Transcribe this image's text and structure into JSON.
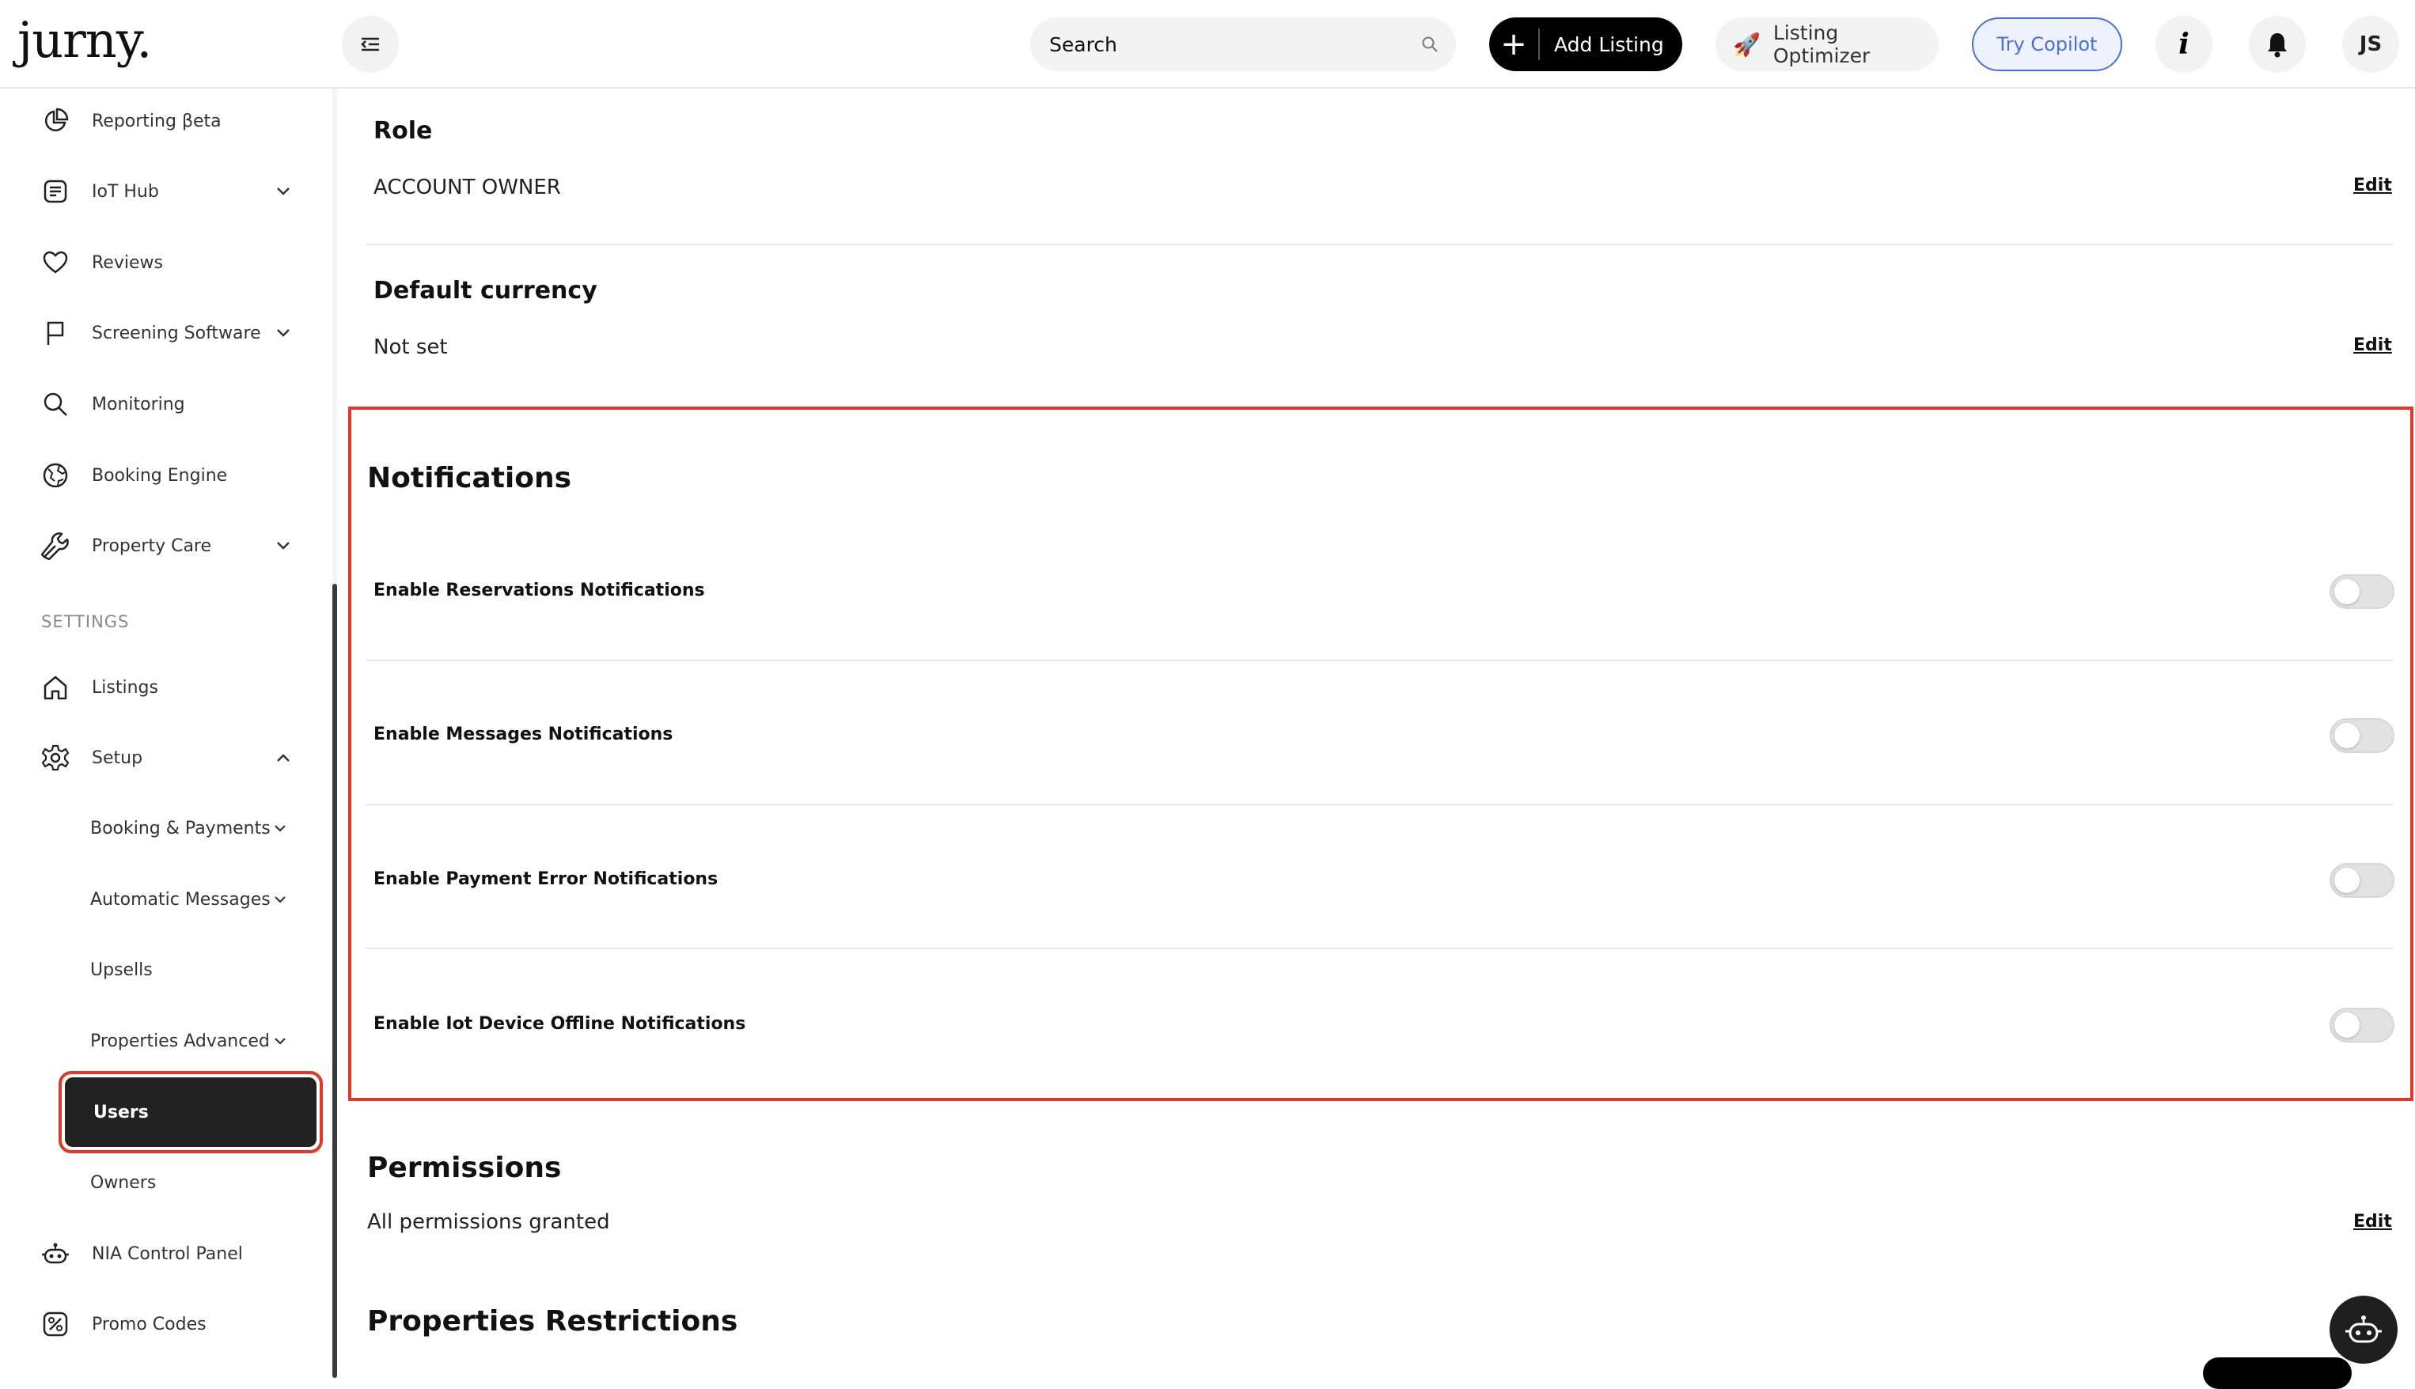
{
  "header": {
    "logo": "jurny.",
    "search_placeholder": "Search",
    "add_listing": "Add Listing",
    "optimizer": "Listing Optimizer",
    "copilot": "Try Copilot",
    "avatar_initials": "JS"
  },
  "sidebar": {
    "items": [
      {
        "label": "Reporting βeta"
      },
      {
        "label": "IoT Hub"
      },
      {
        "label": "Reviews"
      },
      {
        "label": "Screening Software"
      },
      {
        "label": "Monitoring"
      },
      {
        "label": "Booking Engine"
      },
      {
        "label": "Property Care"
      }
    ],
    "settings_heading": "SETTINGS",
    "settings_items": [
      {
        "label": "Listings"
      },
      {
        "label": "Setup"
      }
    ],
    "setup_subitems": [
      {
        "label": "Booking & Payments"
      },
      {
        "label": "Automatic Messages"
      },
      {
        "label": "Upsells"
      },
      {
        "label": "Properties Advanced"
      },
      {
        "label": "Users"
      },
      {
        "label": "Owners"
      }
    ],
    "bottom_items": [
      {
        "label": "NIA Control Panel"
      },
      {
        "label": "Promo Codes"
      }
    ]
  },
  "main": {
    "role": {
      "title": "Role",
      "value": "ACCOUNT OWNER",
      "edit": "Edit"
    },
    "currency": {
      "title": "Default currency",
      "value": "Not set",
      "edit": "Edit"
    },
    "notifications": {
      "title": "Notifications",
      "items": [
        {
          "label": "Enable Reservations Notifications",
          "enabled": false
        },
        {
          "label": "Enable Messages Notifications",
          "enabled": false
        },
        {
          "label": "Enable Payment Error Notifications",
          "enabled": false
        },
        {
          "label": "Enable Iot Device Offline Notifications",
          "enabled": false
        }
      ]
    },
    "permissions": {
      "title": "Permissions",
      "value": "All permissions granted",
      "edit": "Edit"
    },
    "restrictions": {
      "title": "Properties Restrictions"
    }
  },
  "colors": {
    "highlight": "#e0392b",
    "accent": "#4a6fdc",
    "active_bg": "#222222"
  }
}
